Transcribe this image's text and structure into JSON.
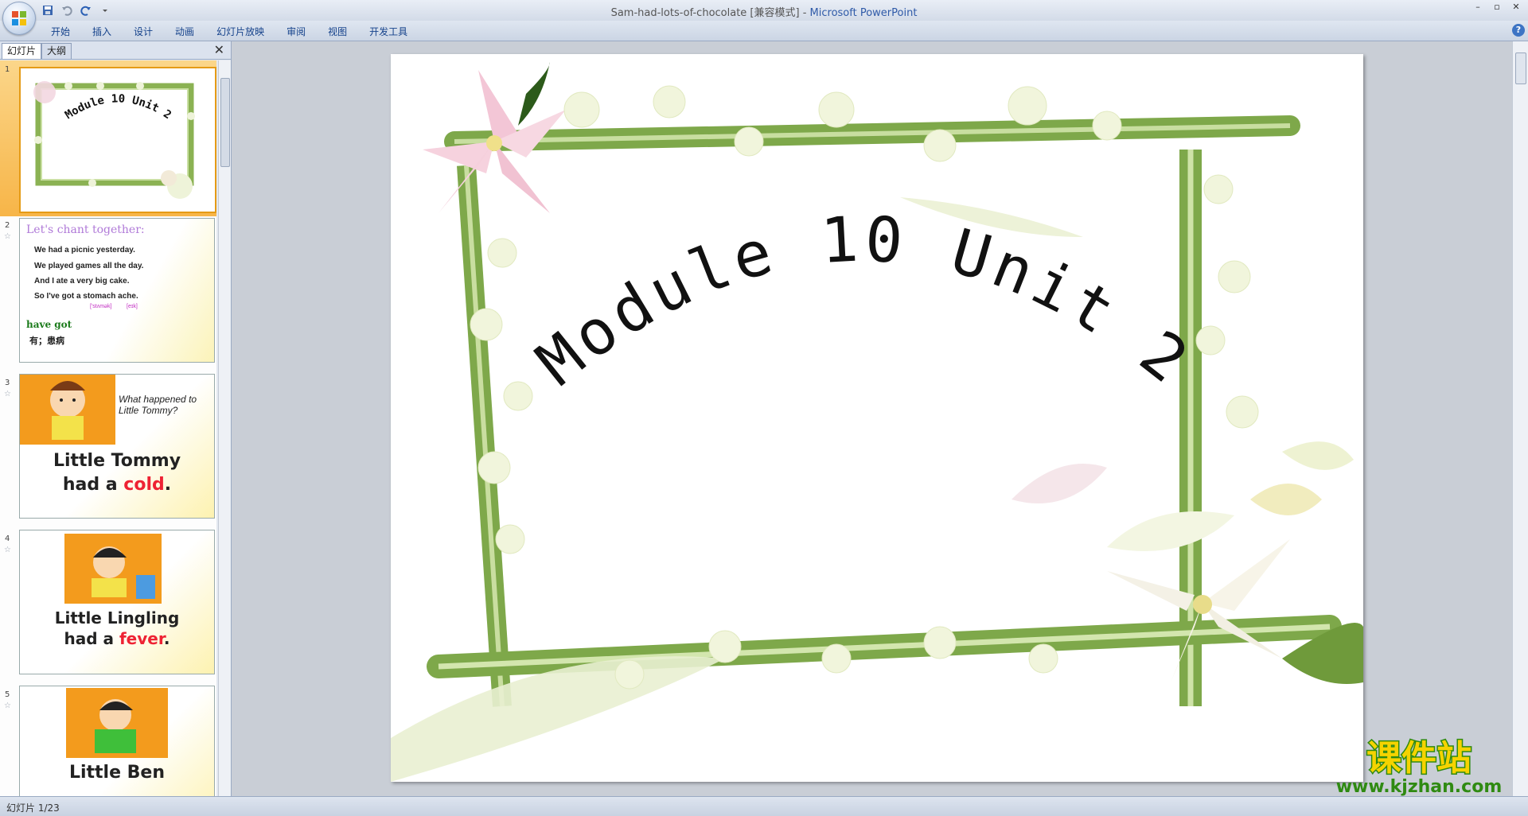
{
  "window": {
    "title_file": "Sam-had-lots-of-chocolate [兼容模式]",
    "title_sep": " - ",
    "title_app": "Microsoft PowerPoint",
    "controls": [
      "–",
      "▫",
      "✕"
    ]
  },
  "ribbon": {
    "tabs": [
      "开始",
      "插入",
      "设计",
      "动画",
      "幻灯片放映",
      "审阅",
      "视图",
      "开发工具"
    ],
    "help": "?"
  },
  "left_pane": {
    "tabs": [
      "幻灯片",
      "大纲"
    ],
    "close": "✕",
    "slides": [
      {
        "num": "1",
        "title": "Module 10 Unit 2"
      },
      {
        "num": "2",
        "heading": "Let's chant together:",
        "lines": [
          "We had a picnic yesterday.",
          "We played games all the day.",
          "And I ate a very big cake.",
          "So I've got a stomach ache."
        ],
        "phonetic1": "['stʌmək]",
        "phonetic2": "[eɪk]",
        "term": "have got",
        "term_cn": "有；患病"
      },
      {
        "num": "3",
        "question": "What happened to Little Tommy?",
        "line1": "Little Tommy",
        "line2_a": "had a ",
        "line2_b": "cold",
        "line2_c": "."
      },
      {
        "num": "4",
        "line1": "Little Lingling",
        "line2_a": "had a ",
        "line2_b": "fever",
        "line2_c": "."
      },
      {
        "num": "5",
        "line1": "Little Ben"
      }
    ]
  },
  "slide": {
    "title": "Module 10 Unit 2"
  },
  "status": {
    "text": "幻灯片 1/23"
  },
  "watermark": {
    "text_cn": "课件站",
    "text_url": "www.kjzhan.com"
  },
  "colors": {
    "accent": "#15428b",
    "app_title": "#2f5aa8",
    "selected_thumb": "#f7b548",
    "watermark_yellow": "#f5d300",
    "watermark_green": "#2f8a12"
  }
}
